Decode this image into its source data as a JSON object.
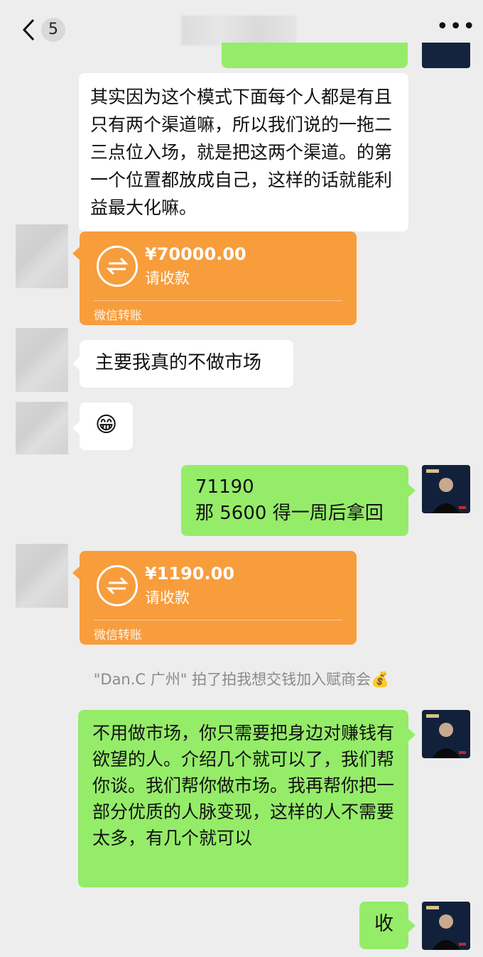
{
  "header": {
    "unread_count": "5",
    "more_label": "•••"
  },
  "messages": {
    "m1_text": "其实因为这个模式下面每个人都是有且只有两个渠道嘛，所以我们说的一拖二三点位入场，就是把这两个渠道。的第一个位置都放成自己，这样的话就能利益最大化嘛。",
    "m2_amount": "¥70000.00",
    "m2_status": "请收款",
    "m2_label": "微信转账",
    "m3_text": "主要我真的不做市场",
    "m4_emoji": "😁",
    "m5_line1": "71190",
    "m5_line2": "那 5600 得一周后拿回",
    "m6_amount": "¥1190.00",
    "m6_status": "请收款",
    "m6_label": "微信转账",
    "system_text": "\"Dan.C 广州\" 拍了拍我想交钱加入赋商会💰",
    "m7_text": "不用做市场，你只需要把身边对赚钱有欲望的人。介绍几个就可以了，我们帮你谈。我们帮你做市场。我再帮你把一部分优质的人脉变现，这样的人不需要太多，有几个就可以",
    "m8_text": "收"
  },
  "colors": {
    "bg": "#ededed",
    "green_bubble": "#95ec69",
    "transfer": "#f79d3c"
  }
}
